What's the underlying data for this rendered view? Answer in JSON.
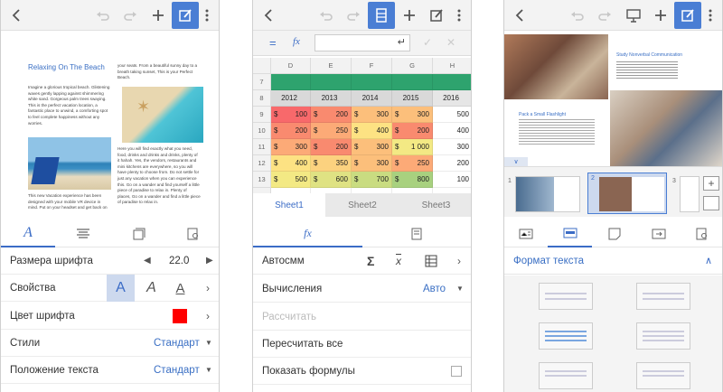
{
  "screen1": {
    "toolbar_icons": [
      "back-icon",
      "undo-icon",
      "redo-icon",
      "plus-icon",
      "edit-icon",
      "more-icon"
    ],
    "doc": {
      "title": "Relaxing On The Beach",
      "col1_text": "Imagine a glorious tropical beach. Glistening waves gently lapping against shimmering white sand. Gorgeous palm trees swaying. This is the perfect vacation location, a fantastic place to unwind, a comforting spot to feel complete happiness without any worries.",
      "col1_text2": "This new Vacation experience has been designed with your mobile VR device in mind. Put on your headset and get back on",
      "col2_text": "your seats. From a beautiful sunny day to a breath taking sunset, This is your Perfect Beach.",
      "col2_text2": "Here you will find exactly what you need, food, drinks and drinks and drinks, plenty of it hahah. Yes, the vendors, restaurants and mini kitchens are everywhere, so you will have plenty to choose from. Do not settle for just any vacation when you can experience this. Go on a wander and find yourself a little piece of paradise to relax in. Plenty of places, Go on a wander and find a little piece of paradise to relax in."
    },
    "rows": {
      "font_size_label": "Размера шрифта",
      "font_size_value": "22.0",
      "props_label": "Свойства",
      "font_color_label": "Цвет шрифта",
      "font_color": "#ff0000",
      "styles_label": "Стили",
      "styles_value": "Стандарт",
      "text_pos_label": "Положение текста",
      "text_pos_value": "Стандарт"
    },
    "glyph_A": "A",
    "accent": "#3b6cc6"
  },
  "screen2": {
    "toolbar_icons": [
      "back-icon",
      "undo-icon",
      "redo-icon",
      "sheet-icon",
      "plus-icon",
      "edit-icon",
      "more-icon"
    ],
    "formula_eq": "=",
    "fx": "fx",
    "columns": [
      "D",
      "E",
      "F",
      "G",
      "H"
    ],
    "rows": [
      {
        "n": "7",
        "cells": [
          "",
          "",
          "",
          "",
          ""
        ]
      },
      {
        "n": "8",
        "cells": [
          "2012",
          "2013",
          "2014",
          "2015",
          "2016"
        ]
      },
      {
        "n": "9",
        "cells": [
          "100",
          "200",
          "300",
          "300",
          "500"
        ]
      },
      {
        "n": "10",
        "cells": [
          "200",
          "250",
          "400",
          "200",
          "400"
        ]
      },
      {
        "n": "11",
        "cells": [
          "300",
          "200",
          "300",
          "1 000",
          "300"
        ]
      },
      {
        "n": "12",
        "cells": [
          "400",
          "350",
          "300",
          "250",
          "200"
        ]
      },
      {
        "n": "13",
        "cells": [
          "500",
          "600",
          "700",
          "800",
          "100"
        ]
      },
      {
        "n": "14",
        "cells": [
          "",
          "",
          "",
          "",
          ""
        ]
      }
    ],
    "currency": "$",
    "sheets": [
      "Sheet1",
      "Sheet2",
      "Sheet3"
    ],
    "menu": {
      "autosum": "Автосмм",
      "calc_label": "Вычисления",
      "calc_value": "Авто",
      "recalc": "Рассчитать",
      "recalc_all": "Пересчитать все",
      "show_formulas": "Показать формулы"
    }
  },
  "screen3": {
    "toolbar_icons": [
      "back-icon",
      "undo-icon",
      "redo-icon",
      "present-icon",
      "plus-icon",
      "edit-icon",
      "more-icon"
    ],
    "slide": {
      "heading1": "Study Nonverbal Communication",
      "heading2": "Pack a Small Flashlight"
    },
    "thumbs": [
      "1",
      "2",
      "3"
    ],
    "format_text": "Формат текста"
  }
}
